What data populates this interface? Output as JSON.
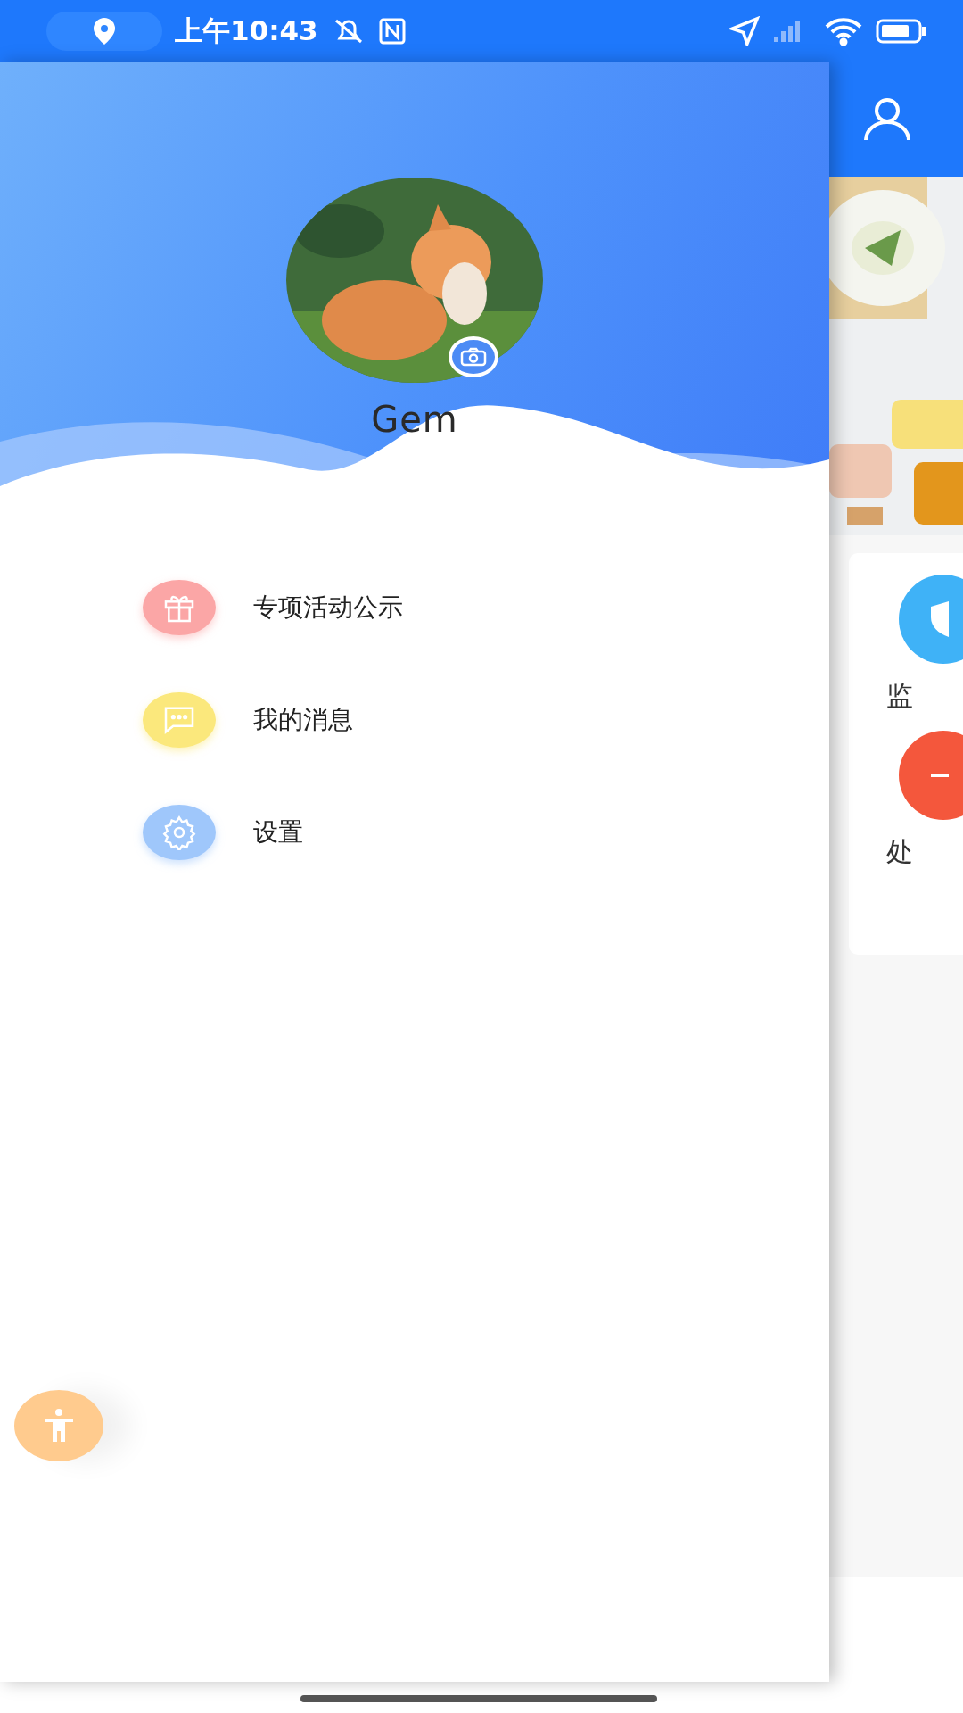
{
  "status_bar": {
    "time": "上午10:43"
  },
  "drawer": {
    "user_name": "Gem",
    "menu": [
      {
        "kind": "gift",
        "label": "专项活动公示"
      },
      {
        "kind": "message",
        "label": "我的消息"
      },
      {
        "kind": "settings",
        "label": "设置"
      }
    ]
  },
  "main": {
    "services": [
      {
        "kind": "shield",
        "label": "监"
      },
      {
        "kind": "minus",
        "label": "处"
      }
    ]
  }
}
